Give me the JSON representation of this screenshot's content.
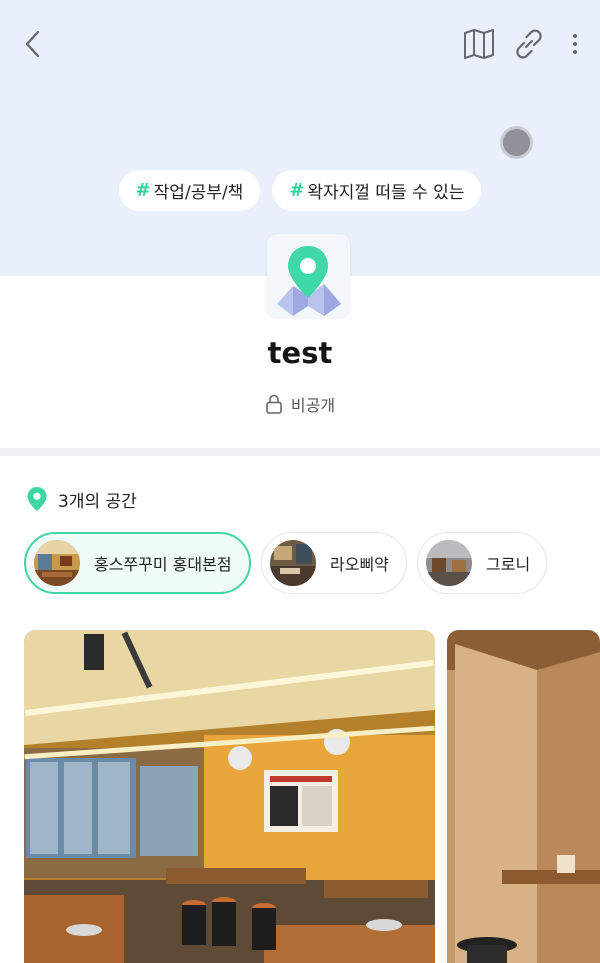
{
  "header": {
    "back_icon": "chevron-left-icon",
    "map_icon": "map-icon",
    "link_icon": "link-icon",
    "more_icon": "more-vertical-icon"
  },
  "tags": [
    {
      "hash": "#",
      "label": "작업/공부/책"
    },
    {
      "hash": "#",
      "label": "왁자지껄 떠들 수 있는"
    }
  ],
  "collection": {
    "title": "test",
    "privacy_label": "비공개",
    "privacy_icon": "lock-icon"
  },
  "places_section": {
    "count_label": "3개의 공간",
    "icon": "location-pin-icon",
    "places": [
      {
        "name": "홍스쭈꾸미 홍대본점",
        "selected": true
      },
      {
        "name": "라오삐약",
        "selected": false
      },
      {
        "name": "그로니",
        "selected": false
      }
    ]
  },
  "colors": {
    "hero_bg": "#e9f0fb",
    "accent_green": "#2fd39b",
    "chip_selected_border": "#41d7a4"
  }
}
